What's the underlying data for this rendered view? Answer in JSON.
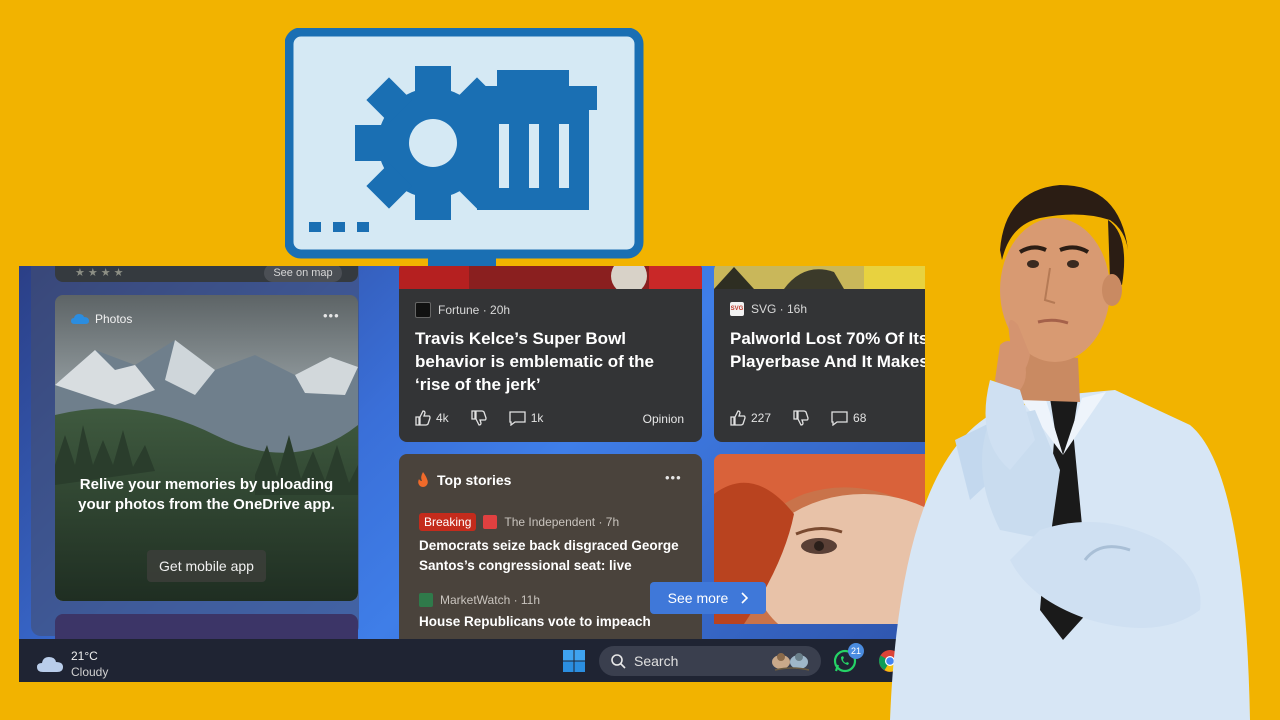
{
  "colors": {
    "background": "#F2B300",
    "card": "#333436",
    "top_stories_card": "#4a433c",
    "taskbar": "#1f2433",
    "accent_blue": "#3f78d9",
    "breaking_red": "#c42b1c",
    "icon_blue": "#1a6fb3"
  },
  "icons": {
    "monitor": "monitor-gear-trash-icon",
    "weather": "cloud-icon",
    "start": "windows-logo-icon",
    "search": "search-icon",
    "whatsapp": "whatsapp-icon",
    "chrome": "chrome-icon"
  },
  "map_card": {
    "button": "See on map"
  },
  "photos": {
    "title": "Photos",
    "message": "Relive your memories by uploading your photos from the OneDrive app.",
    "button": "Get mobile app"
  },
  "articles": [
    {
      "source": "Fortune · 20h",
      "headline_lines": [
        "Travis Kelce’s Super Bowl",
        "behavior is emblematic of the",
        "‘rise of the jerk’"
      ],
      "likes": "4k",
      "comments": "1k",
      "tag": "Opinion"
    },
    {
      "source": "SVG · 16h",
      "logo_text": "SVG",
      "headline_lines": [
        "Palworld Lost 70% Of Its",
        "Playerbase And It Makes"
      ],
      "likes": "227",
      "comments": "68"
    }
  ],
  "top_stories": {
    "title": "Top stories",
    "stories": [
      {
        "badge": "Breaking",
        "source": "The Independent · 7h",
        "lines": [
          "Democrats seize back disgraced George",
          "Santos’s congressional seat: live"
        ]
      },
      {
        "source": "MarketWatch · 11h",
        "lines": [
          "House Republicans vote to impeach"
        ]
      }
    ],
    "see_more": "See more"
  },
  "taskbar": {
    "temperature": "21°C",
    "condition": "Cloudy",
    "search_label": "Search",
    "whatsapp_badge": "21"
  }
}
